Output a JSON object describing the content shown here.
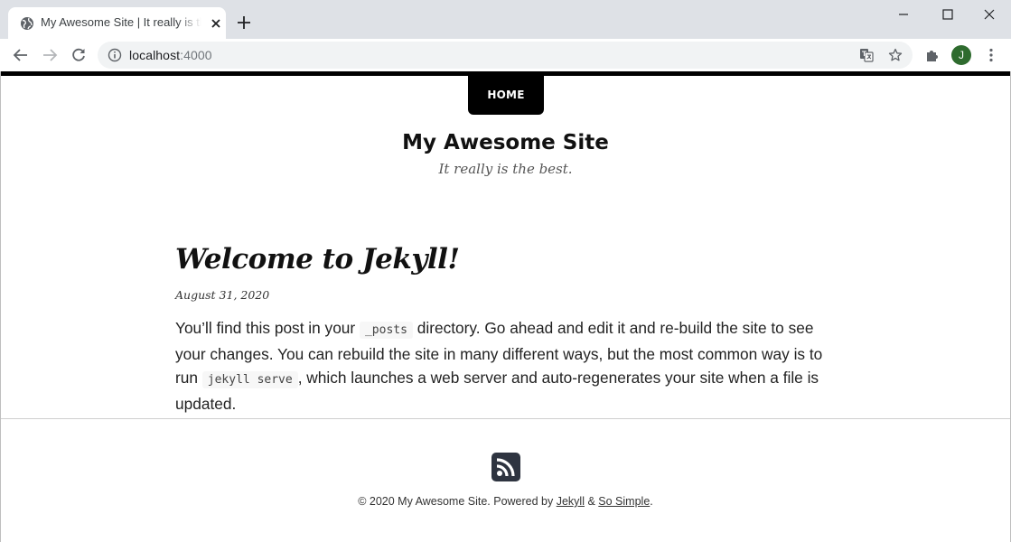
{
  "browser": {
    "tab_title": "My Awesome Site | It really is the best.",
    "url_host": "localhost",
    "url_port": ":4000",
    "profile_initial": "J",
    "icons": {
      "favicon": "globe-icon",
      "close": "close-icon",
      "new_tab": "plus-icon",
      "back": "back-arrow-icon",
      "forward": "forward-arrow-icon",
      "reload": "reload-icon",
      "info": "info-icon",
      "translate": "translate-icon",
      "bookmark": "star-icon",
      "extensions": "puzzle-icon",
      "menu": "kebab-menu-icon"
    },
    "colors": {
      "tabstrip": "#dee1e6",
      "avatar": "#2e6b2e"
    }
  },
  "site": {
    "nav_home": "HOME",
    "title": "My Awesome Site",
    "description": "It really is the best."
  },
  "post": {
    "title": "Welcome to Jekyll!",
    "date": "August 31, 2020",
    "body_1": "You’ll find this post in your ",
    "code_1": "_posts",
    "body_2": " directory. Go ahead and edit it and re-build the site to see your changes. You can rebuild the site in many different ways, but the most common way is to run ",
    "code_2": "jekyll serve",
    "body_3": ", which launches a web server and auto-regenerates your site when a file is updated."
  },
  "footer": {
    "rss_icon": "rss-feed-icon",
    "copyright": "© 2020 My Awesome Site. Powered by ",
    "link_jekyll": "Jekyll",
    "amp": " & ",
    "link_so_simple": "So Simple",
    "end": "."
  }
}
